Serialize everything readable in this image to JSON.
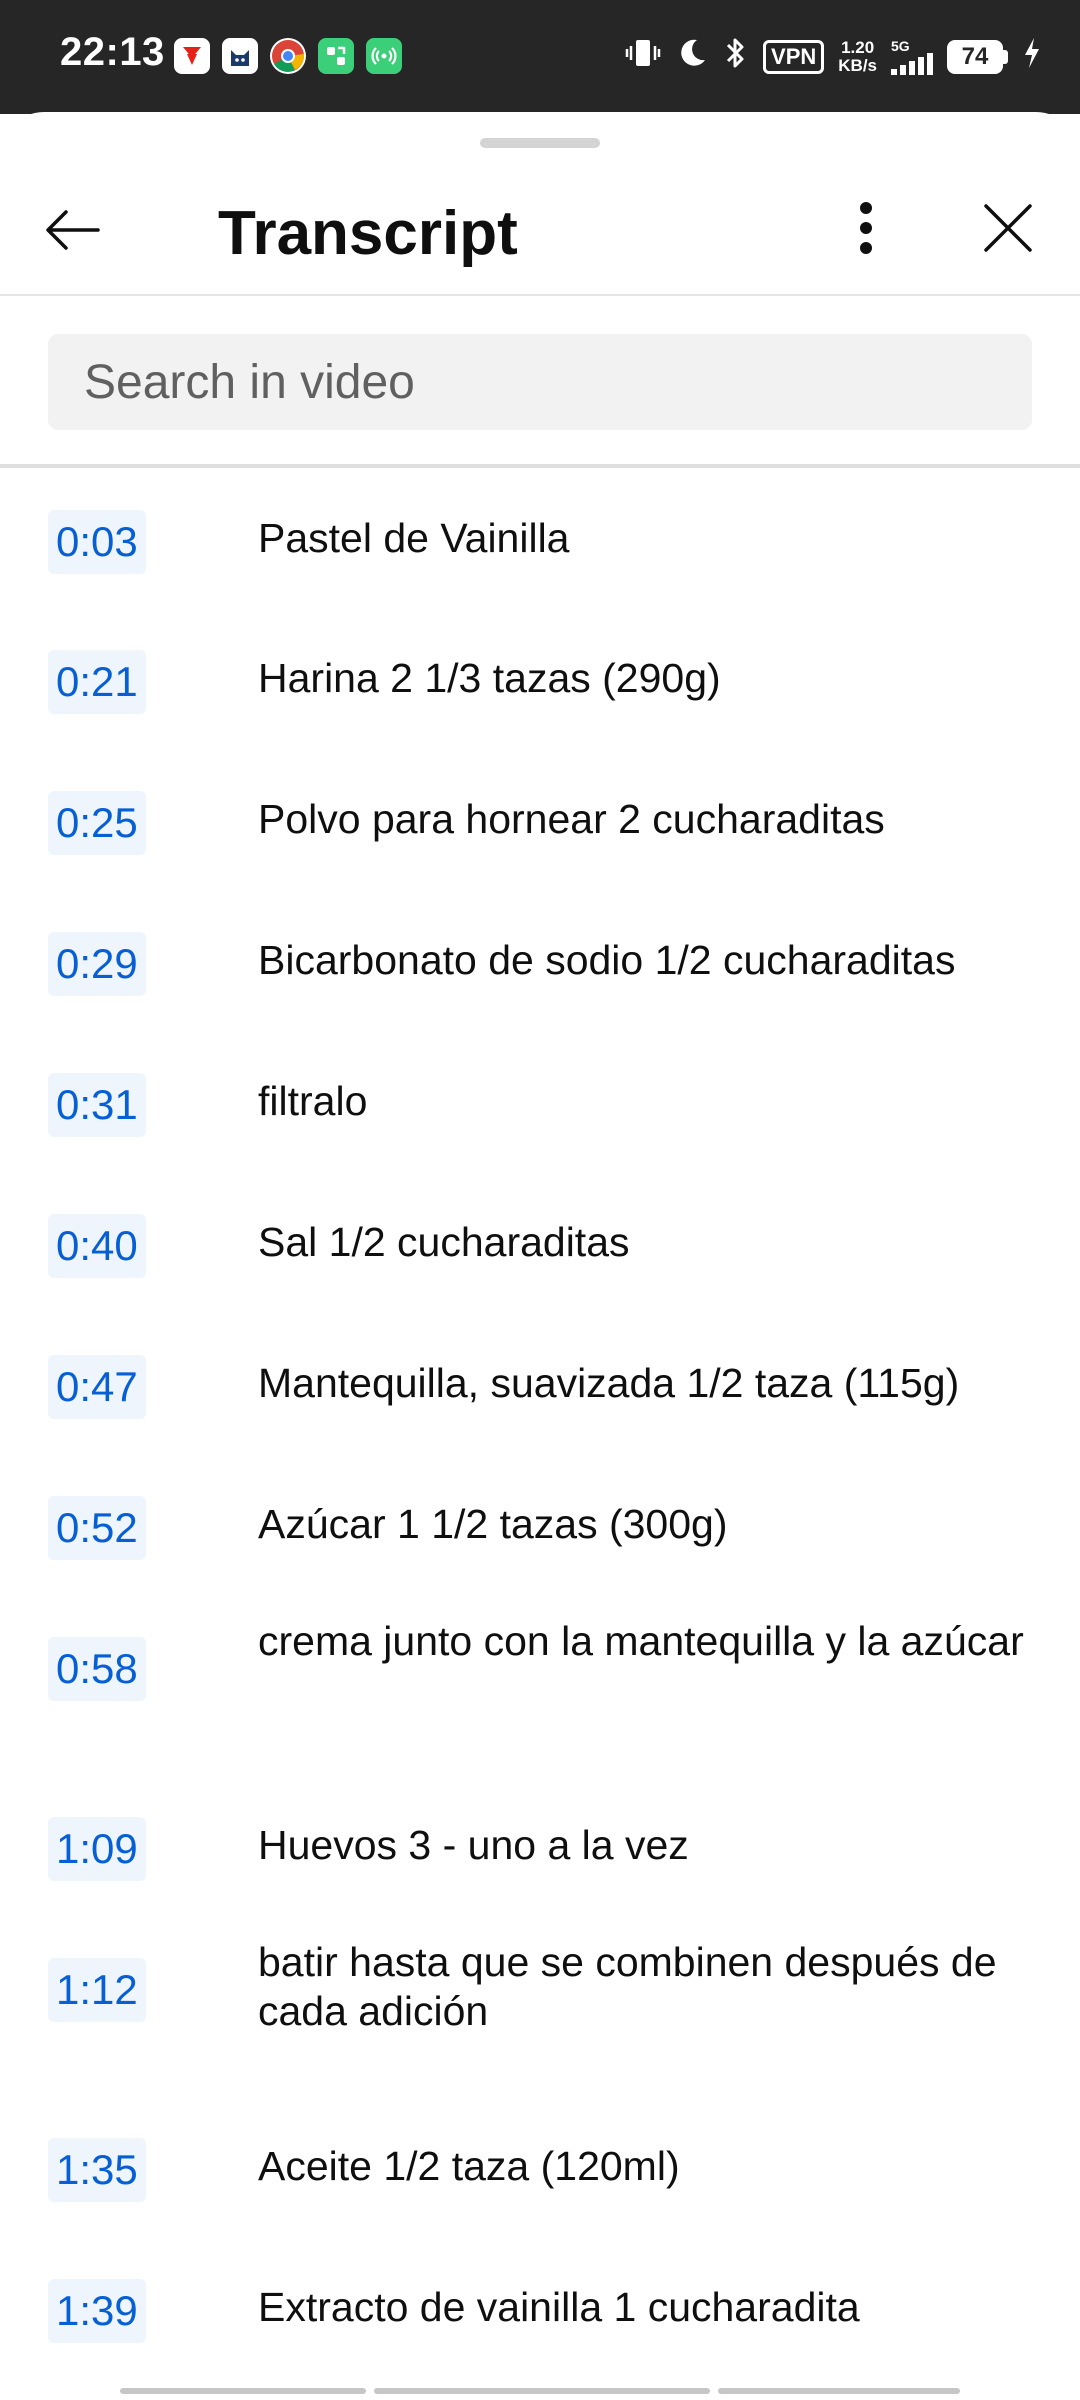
{
  "status_bar": {
    "time": "22:13",
    "vpn": "VPN",
    "net_speed_value": "1.20",
    "net_speed_unit": "KB/s",
    "network_type": "5G",
    "battery": "74",
    "app_icons": [
      "flag-app-icon",
      "cat-app-icon",
      "chrome-icon",
      "green-app-icon",
      "hotspot-icon"
    ]
  },
  "header": {
    "title": "Transcript"
  },
  "search": {
    "placeholder": "Search in video",
    "value": ""
  },
  "transcript": [
    {
      "time": "0:03",
      "text": "Pastel de Vainilla"
    },
    {
      "time": "0:21",
      "text": "Harina 2 1/3 tazas (290g)"
    },
    {
      "time": "0:25",
      "text": "Polvo para hornear 2 cucharaditas"
    },
    {
      "time": "0:29",
      "text": "Bicarbonato de sodio 1/2 cucharaditas"
    },
    {
      "time": "0:31",
      "text": "filtralo"
    },
    {
      "time": "0:40",
      "text": "Sal 1/2 cucharaditas"
    },
    {
      "time": "0:47",
      "text": "Mantequilla, suavizada 1/2 taza (115g)"
    },
    {
      "time": "0:52",
      "text": "Azúcar 1 1/2 tazas (300g)"
    },
    {
      "time": "0:58",
      "text": "crema junto con la mantequilla y la azúcar"
    },
    {
      "time": "1:09",
      "text": "Huevos 3 - uno a la vez"
    },
    {
      "time": "1:12",
      "text": "batir hasta que se combinen después de cada adición"
    },
    {
      "time": "1:35",
      "text": "Aceite 1/2 taza (120ml)"
    },
    {
      "time": "1:39",
      "text": "Extracto de vainilla 1 cucharadita"
    }
  ],
  "colors": {
    "status_bar_bg": "#262626",
    "timestamp_blue": "#065fd4",
    "timestamp_bg": "#eff5fd",
    "search_bg": "#f2f2f2"
  }
}
